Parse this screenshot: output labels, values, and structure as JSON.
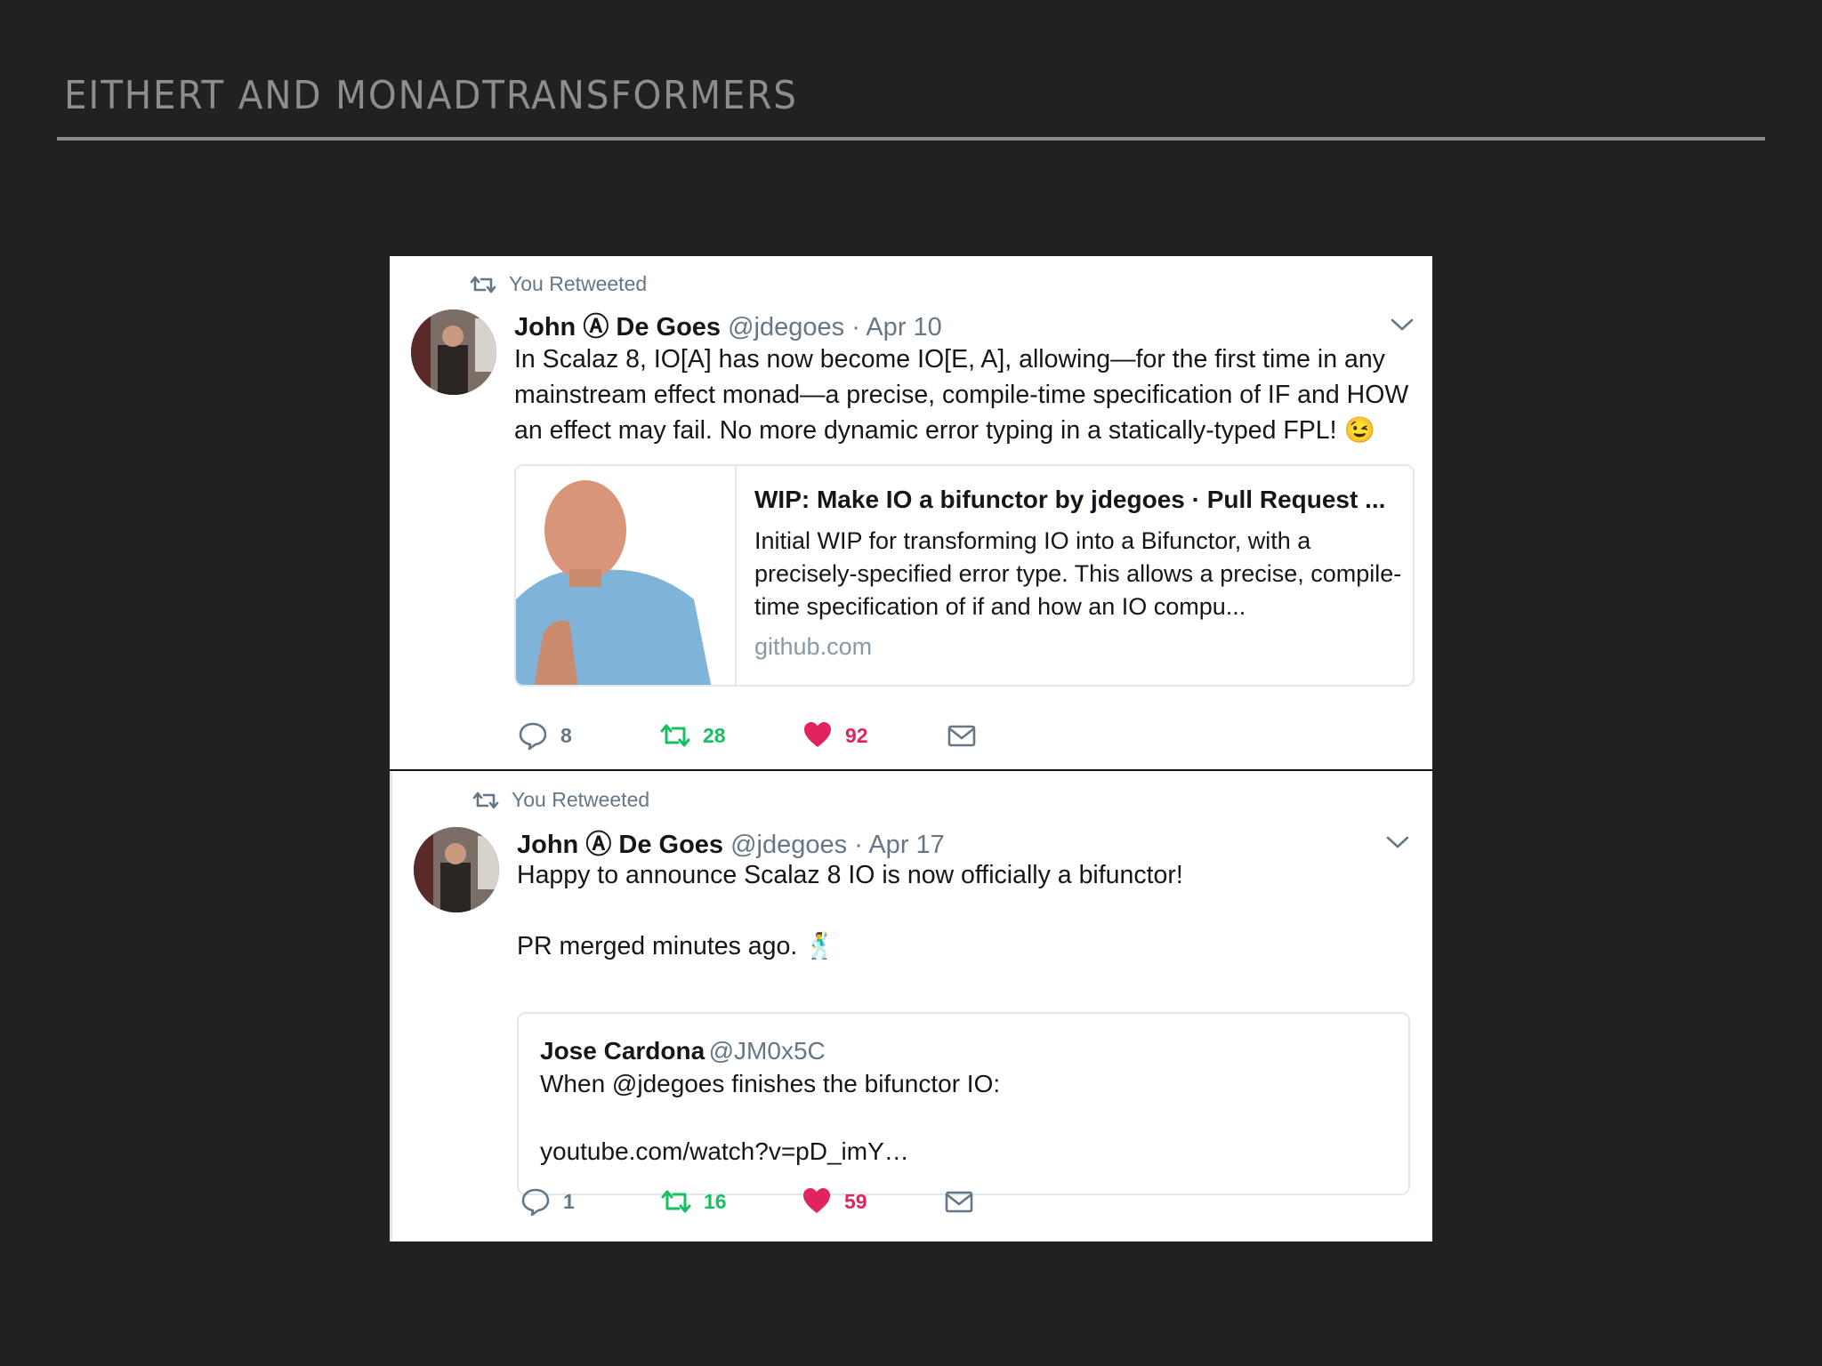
{
  "slide": {
    "title": "EITHERT AND MONADTRANSFORMERS"
  },
  "tweets": [
    {
      "context": "You Retweeted",
      "name": "John Ⓐ De Goes",
      "handle": "@jdegoes",
      "separator": "·",
      "date": "Apr 10",
      "text": "In Scalaz 8, IO[A] has now become IO[E, A], allowing—for the first time in any mainstream effect monad—a precise, compile-time specification of IF and HOW an effect may fail. No more dynamic error typing in a statically-typed FPL!",
      "emoji": "😉",
      "card": {
        "title": "WIP: Make IO a bifunctor by jdegoes · Pull Request ...",
        "description": "Initial WIP for transforming IO into a Bifunctor, with a precisely-specified error type. This allows a precise, compile-time specification of if and how an IO compu...",
        "domain": "github.com"
      },
      "replies": "8",
      "retweets": "28",
      "likes": "92"
    },
    {
      "context": "You Retweeted",
      "name": "John Ⓐ De Goes",
      "handle": "@jdegoes",
      "separator": "·",
      "date": "Apr 17",
      "text_line1": "Happy to announce Scalaz 8 IO is now officially a bifunctor!",
      "text_line2": "PR merged minutes ago.",
      "emoji": "🕺",
      "quote": {
        "name": "Jose Cardona",
        "handle": "@JM0x5C",
        "text": "When @jdegoes finishes the bifunctor IO:",
        "link": "youtube.com/watch?v=pD_imY…"
      },
      "replies": "1",
      "retweets": "16",
      "likes": "59"
    }
  ],
  "colors": {
    "background": "#212123",
    "retweet_green": "#17bf63",
    "like_red": "#e0245e",
    "muted": "#657786"
  },
  "icons": [
    "retweet-icon",
    "caret-down-icon",
    "reply-icon",
    "heart-icon",
    "mail-icon"
  ]
}
